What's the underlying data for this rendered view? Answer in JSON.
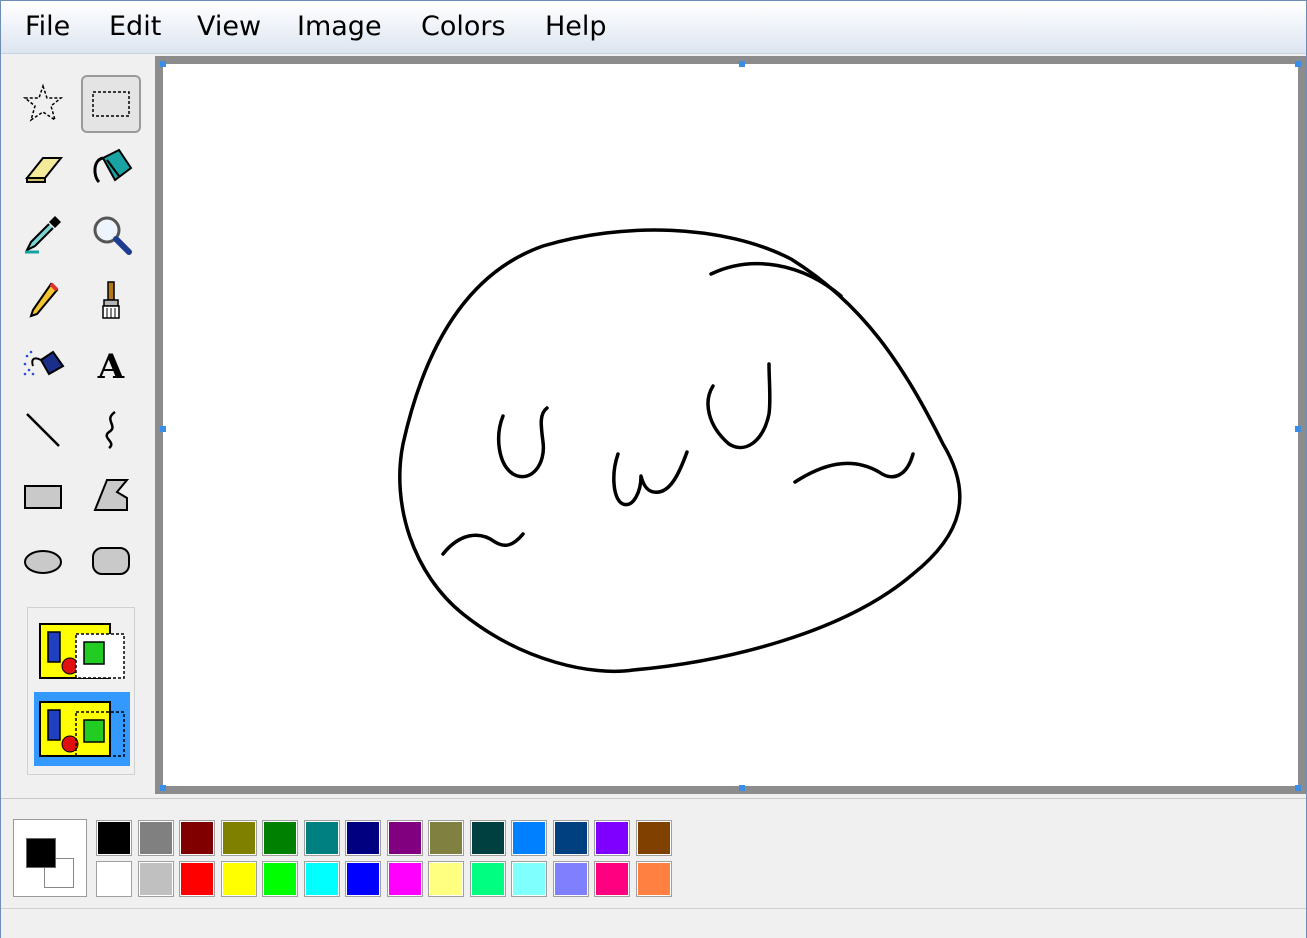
{
  "menu": {
    "file": "File",
    "edit": "Edit",
    "view": "View",
    "image": "Image",
    "colors": "Colors",
    "help": "Help"
  },
  "tools": [
    {
      "name": "free-form-select",
      "icon": "free-form-select-icon",
      "selected": false
    },
    {
      "name": "select",
      "icon": "rect-select-icon",
      "selected": true
    },
    {
      "name": "eraser",
      "icon": "eraser-icon",
      "selected": false
    },
    {
      "name": "fill",
      "icon": "fill-bucket-icon",
      "selected": false
    },
    {
      "name": "pick-color",
      "icon": "eyedropper-icon",
      "selected": false
    },
    {
      "name": "magnifier",
      "icon": "magnifier-icon",
      "selected": false
    },
    {
      "name": "pencil",
      "icon": "pencil-icon",
      "selected": false
    },
    {
      "name": "brush",
      "icon": "brush-icon",
      "selected": false
    },
    {
      "name": "airbrush",
      "icon": "airbrush-icon",
      "selected": false
    },
    {
      "name": "text",
      "icon": "text-icon",
      "selected": false
    },
    {
      "name": "line",
      "icon": "line-icon",
      "selected": false
    },
    {
      "name": "curve",
      "icon": "curve-icon",
      "selected": false
    },
    {
      "name": "rectangle",
      "icon": "rectangle-icon",
      "selected": false
    },
    {
      "name": "polygon",
      "icon": "polygon-icon",
      "selected": false
    },
    {
      "name": "ellipse",
      "icon": "ellipse-icon",
      "selected": false
    },
    {
      "name": "rounded-rectangle",
      "icon": "rounded-rectangle-icon",
      "selected": false
    }
  ],
  "tool_options": [
    {
      "name": "opaque-selection",
      "icon": "opaque-selection-icon",
      "selected": false
    },
    {
      "name": "transparent-selection",
      "icon": "transparent-selection-icon",
      "selected": true
    }
  ],
  "current_colors": {
    "foreground": "#000000",
    "background": "#ffffff"
  },
  "palette": {
    "top": [
      "#000000",
      "#808080",
      "#800000",
      "#808000",
      "#008000",
      "#008080",
      "#000080",
      "#800080",
      "#808040",
      "#004040",
      "#0080ff",
      "#004080",
      "#8000ff",
      "#804000"
    ],
    "bottom": [
      "#ffffff",
      "#c0c0c0",
      "#ff0000",
      "#ffff00",
      "#00ff00",
      "#00ffff",
      "#0000ff",
      "#ff00ff",
      "#ffff80",
      "#00ff80",
      "#80ffff",
      "#8080ff",
      "#ff0080",
      "#ff8040"
    ]
  },
  "accent_color": "#3399ff"
}
